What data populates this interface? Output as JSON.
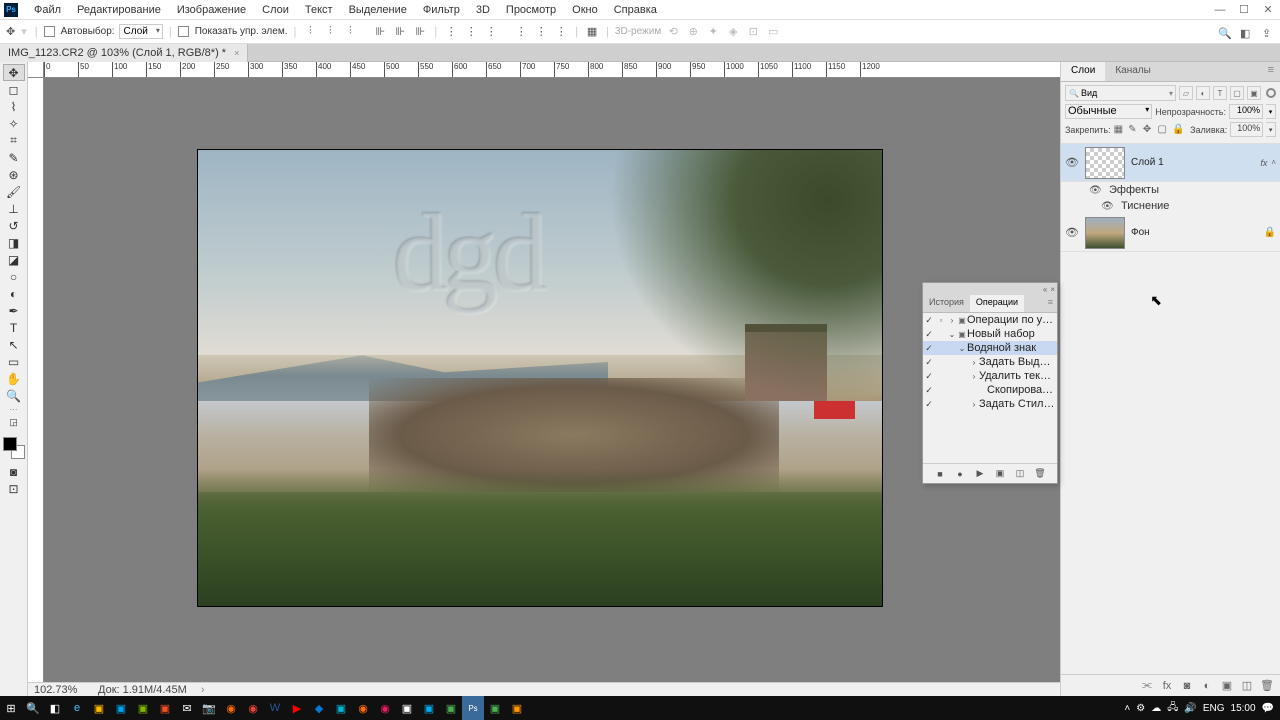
{
  "menu": {
    "items": [
      "Файл",
      "Редактирование",
      "Изображение",
      "Слои",
      "Текст",
      "Выделение",
      "Фильтр",
      "3D",
      "Просмотр",
      "Окно",
      "Справка"
    ]
  },
  "options": {
    "autoselect": "Автовыбор:",
    "autoselect_value": "Слой",
    "show_controls": "Показать упр. элем.",
    "threeD": "3D-режим"
  },
  "doc": {
    "tab": "IMG_1123.CR2 @ 103% (Слой 1, RGB/8*) *"
  },
  "watermark": "dgd",
  "layers": {
    "tab1": "Слои",
    "tab2": "Каналы",
    "search": "Вид",
    "blend": "Обычные",
    "opacity_label": "Непрозрачность:",
    "opacity": "100%",
    "lock_label": "Закрепить:",
    "fill_label": "Заливка:",
    "fill": "100%",
    "layer1": "Слой 1",
    "fx": "fx",
    "fx1": "Эффекты",
    "fx2": "Тиснение",
    "layer2": "Фон"
  },
  "actions": {
    "tab1": "История",
    "tab2": "Операции",
    "r0": "Операции по умол...",
    "r1": "Новый набор",
    "r2": "Водяной знак",
    "r3": "Задать Выделение",
    "r4": "Удалить текущ. ...",
    "r5": "Скопировать на ...",
    "r6": "Задать Стили сл..."
  },
  "status": {
    "zoom": "102.73%",
    "doc": "Док: 1.91M/4.45M"
  },
  "tray": {
    "lang": "ENG",
    "time": "15:00"
  },
  "ruler": [
    "0",
    "50",
    "100",
    "150",
    "200",
    "250",
    "300",
    "350",
    "400",
    "450",
    "500",
    "550",
    "600",
    "650",
    "700",
    "750",
    "800",
    "850",
    "900",
    "950",
    "1000",
    "1050",
    "1100",
    "1150",
    "1200"
  ]
}
